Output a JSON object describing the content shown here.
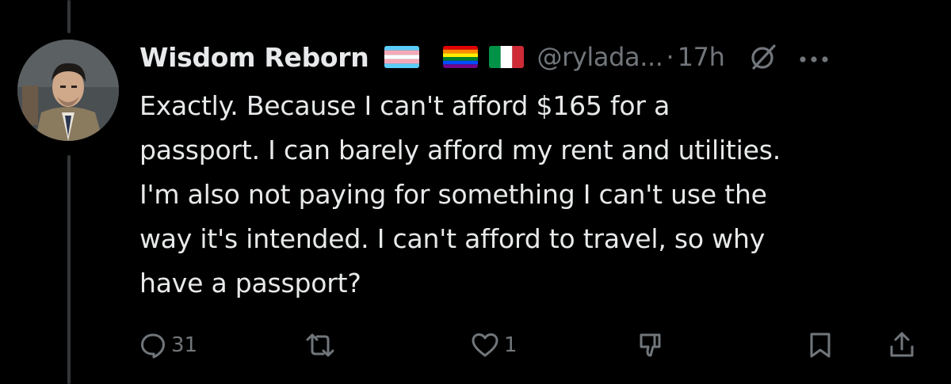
{
  "tweet": {
    "display_name": "Wisdom Reborn",
    "handle": "@rylada...",
    "separator": "·",
    "time": "17h",
    "text_lines": [
      "Exactly. Because I can't afford $165 for a",
      "passport. I can barely afford my rent and utilities.",
      "I'm also not paying for something I can't use the",
      "way it's intended. I can't afford to travel, so why",
      "have a passport?"
    ],
    "flags": [
      "transgender-flag",
      "rainbow-flag",
      "italy-flag"
    ],
    "icons": {
      "header": [
        "grok-icon",
        "more-icon"
      ],
      "actions": [
        "reply-icon",
        "retweet-icon",
        "like-icon",
        "dislike-icon",
        "bookmark-icon",
        "share-icon"
      ]
    }
  },
  "actions": {
    "reply_count": "31",
    "like_count": "1"
  },
  "colors": {
    "background": "#000000",
    "text": "#e7e9ea",
    "muted": "#71767b",
    "thread_line": "#333639"
  }
}
